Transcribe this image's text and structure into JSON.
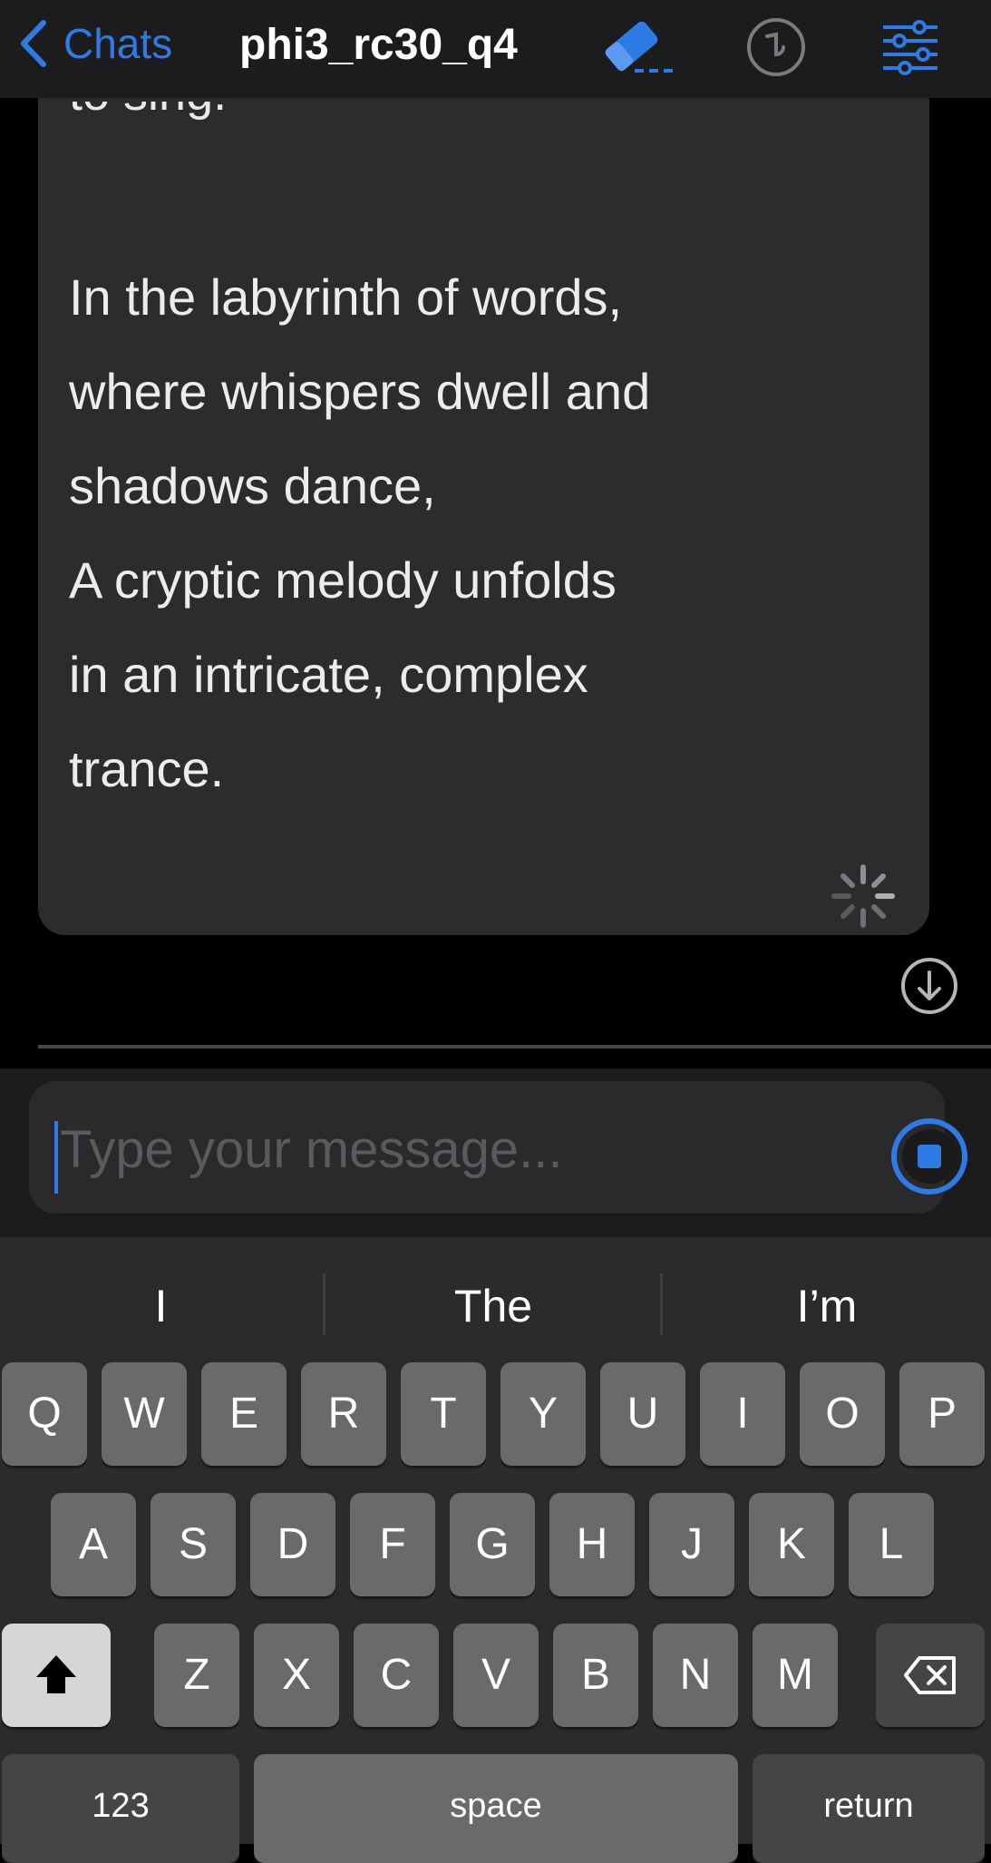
{
  "header": {
    "back_label": "Chats",
    "title": "phi3_rc30_q4",
    "accent_color": "#2f7be6",
    "icons": [
      "chevron-left-icon",
      "eraser-icon",
      "history-icon",
      "sliders-icon"
    ]
  },
  "message": {
    "cut_line": "to sing.",
    "lines": [
      "In the labyrinth of words,",
      "where whispers dwell and",
      "shadows dance,",
      "A cryptic melody unfolds",
      "in an intricate, complex",
      "trance."
    ],
    "status_icon": "loading-spinner-icon"
  },
  "composer": {
    "placeholder": "Type your message...",
    "send_icon": "stop-icon"
  },
  "keyboard": {
    "suggestions": [
      "I",
      "The",
      "I’m"
    ],
    "row1": [
      "Q",
      "W",
      "E",
      "R",
      "T",
      "Y",
      "U",
      "I",
      "O",
      "P"
    ],
    "row2": [
      "A",
      "S",
      "D",
      "F",
      "G",
      "H",
      "J",
      "K",
      "L"
    ],
    "row3": [
      "Z",
      "X",
      "C",
      "V",
      "B",
      "N",
      "M"
    ],
    "numbers_label": "123",
    "space_label": "space",
    "return_label": "return"
  }
}
